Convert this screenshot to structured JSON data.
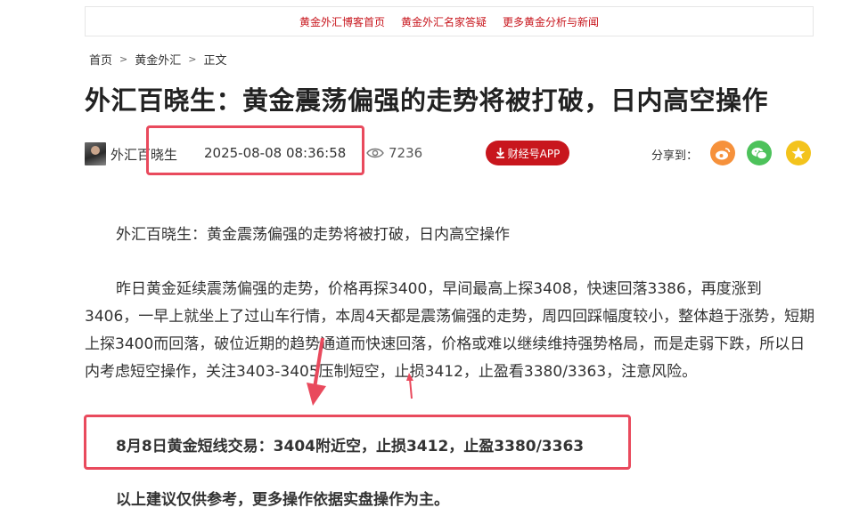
{
  "topnav": {
    "links": [
      "黄金外汇博客首页",
      "黄金外汇名家答疑",
      "更多黄金分析与新闻"
    ]
  },
  "breadcrumb": {
    "items": [
      "首页",
      "黄金外汇",
      "正文"
    ],
    "separator": ">"
  },
  "article": {
    "title": "外汇百晓生：黄金震荡偏强的走势将被打破，日内高空操作",
    "author": "外汇百晓生",
    "datetime": "2025-08-08 08:36:58",
    "views": "7236",
    "app_button": "财经号APP",
    "share_label": "分享到：",
    "paragraphs": [
      "外汇百晓生：黄金震荡偏强的走势将被打破，日内高空操作",
      "昨日黄金延续震荡偏强的走势，价格再探3400，早间最高上探3408，快速回落3386，再度涨到3406，一早上就坐上了过山车行情，本周4天都是震荡偏强的走势，周四回踩幅度较小，整体趋于涨势，短期上探3400而回落，破位近期的趋势通道而快速回落，价格或难以继续维持强势格局，而是走弱下跌，所以日内考虑短空操作，关注3403-3405压制短空，止损3412，止盈看3380/3363，注意风险。",
      "8月8日黄金短线交易：3404附近空，止损3412，止盈3380/3363",
      "以上建议仅供参考，更多操作依据实盘操作为主。"
    ]
  },
  "icons": {
    "views": "eye-icon",
    "download": "download-icon",
    "share": [
      "weibo-icon",
      "wechat-icon",
      "star-icon"
    ]
  },
  "colors": {
    "brand_red": "#c8161d",
    "highlight": "#e94a5d"
  }
}
